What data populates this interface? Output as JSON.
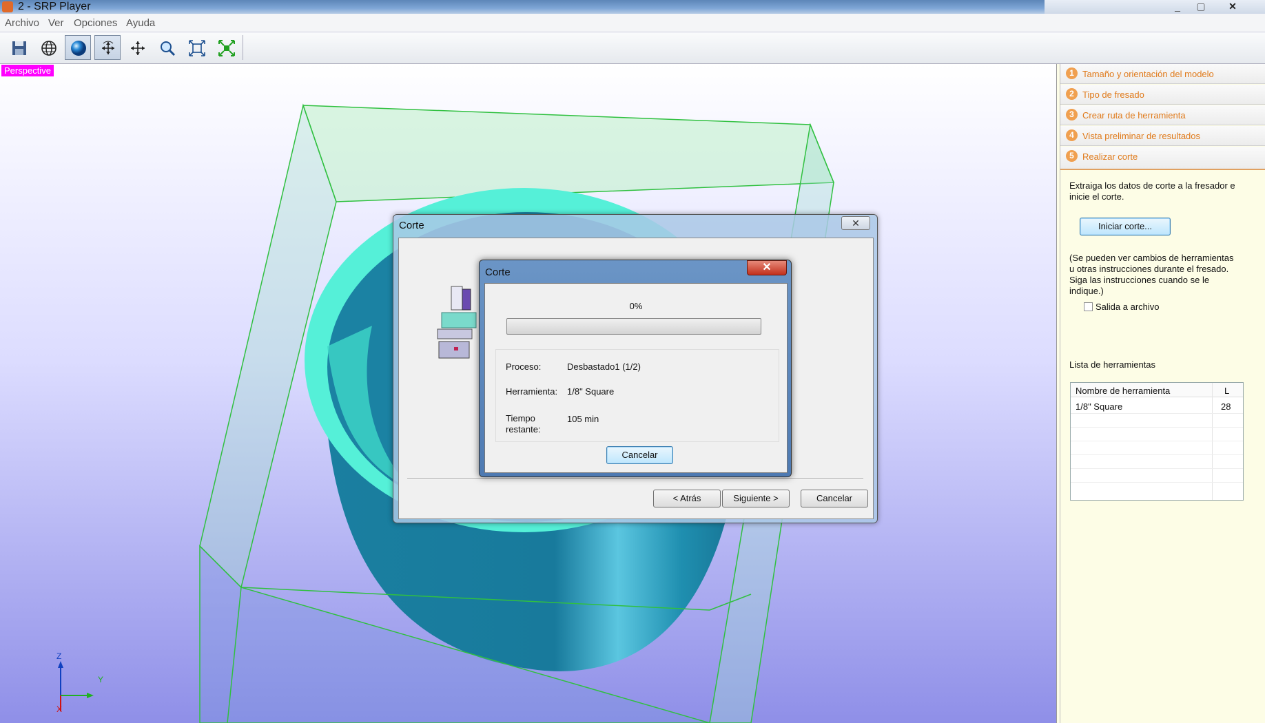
{
  "window": {
    "title": "2 - SRP Player",
    "controls": [
      "_",
      "▢",
      "✕"
    ]
  },
  "menu": [
    "Archivo",
    "Ver",
    "Opciones",
    "Ayuda"
  ],
  "toolbar": {
    "icons": [
      "save-icon",
      "wireframe-globe-icon",
      "shaded-sphere-icon",
      "rotate-icon",
      "pan-icon",
      "zoom-icon",
      "fit-view-icon",
      "center-view-icon"
    ]
  },
  "viewport": {
    "view_label": "Perspective",
    "axes": {
      "z": "Z",
      "y": "Y",
      "x": "X"
    }
  },
  "panel": {
    "steps": [
      {
        "num": "1",
        "label": "Tamaño y orientación del modelo"
      },
      {
        "num": "2",
        "label": "Tipo de fresado"
      },
      {
        "num": "3",
        "label": "Crear ruta de herramienta"
      },
      {
        "num": "4",
        "label": "Vista preliminar de resultados"
      },
      {
        "num": "5",
        "label": "Realizar corte"
      }
    ],
    "intro_line1": "Extraiga los datos de corte a la fresador e",
    "intro_line2": "inicie el corte.",
    "start_button": "Iniciar corte...",
    "note_line1": "(Se pueden ver cambios de herramientas",
    "note_line2": "u otras instrucciones durante el fresado.",
    "note_line3": "Siga las instrucciones cuando se le",
    "note_line4": "indique.)",
    "checkbox_label": "Salida a archivo",
    "checkbox_checked": false,
    "tool_list_title": "Lista de herramientas",
    "tool_table": {
      "headers": [
        "Nombre de herramienta",
        "L"
      ],
      "rows": [
        [
          "1/8\" Square",
          "28"
        ]
      ]
    }
  },
  "outer_dialog": {
    "title": "Corte",
    "back_button": "< Atrás",
    "next_button": "Siguiente >",
    "cancel_button": "Cancelar"
  },
  "inner_dialog": {
    "title": "Corte",
    "progress_text": "0%",
    "progress_fraction": 0,
    "process_label": "Proceso:",
    "process_value": "Desbastado1 (1/2)",
    "tool_label": "Herramienta:",
    "tool_value": "1/8\" Square",
    "time_label_1": "Tiempo",
    "time_label_2": "restante:",
    "time_value": "105 min",
    "cancel_button": "Cancelar"
  }
}
